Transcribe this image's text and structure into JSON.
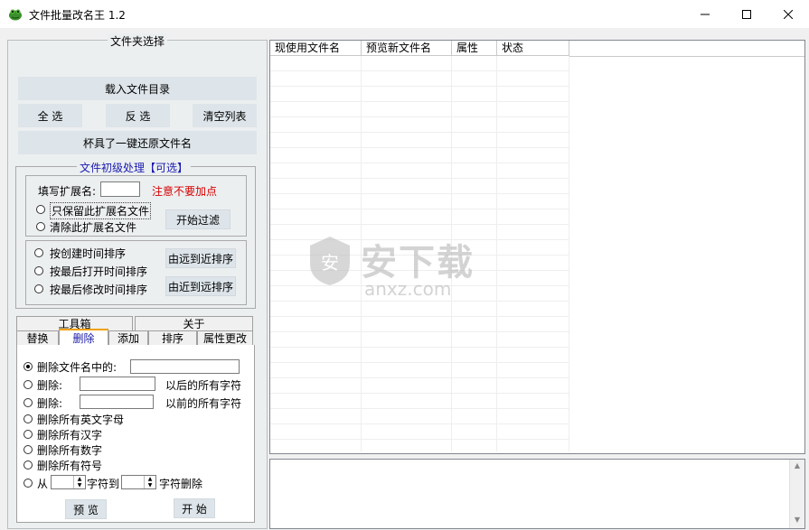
{
  "window": {
    "title": "文件批量改名王  1.2",
    "minimize_glyph": "—",
    "maximize_glyph": "☐",
    "close_glyph": "✕",
    "icon": "frog-app-icon"
  },
  "folder_group": {
    "legend": "文件夹选择",
    "load_dir": "载入文件目录",
    "select_all": "全 选",
    "invert_select": "反 选",
    "clear_list": "清空列表",
    "restore_names": "杯具了一键还原文件名"
  },
  "prefilter_group": {
    "legend": "文件初级处理【可选】",
    "ext_label": "填写扩展名:",
    "ext_value": "",
    "warning": "注意不要加点",
    "keep_ext": "只保留此扩展名文件",
    "remove_ext": "清除此扩展名文件",
    "start_filter": "开始过滤",
    "sort_create": "按创建时间排序",
    "sort_open": "按最后打开时间排序",
    "sort_modify": "按最后修改时间排序",
    "far_to_near": "由远到近排序",
    "near_to_far": "由近到远排序"
  },
  "tabs_top": [
    "工具箱",
    "关于"
  ],
  "tabs": [
    "替换",
    "删除",
    "添加",
    "排序",
    "属性更改"
  ],
  "delete_tab": {
    "opt_contains": "删除文件名中的:",
    "opt_after": "删除:",
    "after_suffix": "以后的所有字符",
    "opt_before": "删除:",
    "before_suffix": "以前的所有字符",
    "opt_english": "删除所有英文字母",
    "opt_chinese": "删除所有汉字",
    "opt_digits": "删除所有数字",
    "opt_symbols": "删除所有符号",
    "opt_range_from": "从",
    "range_to": "字符到",
    "range_delete": "字符删除",
    "preview": "预 览",
    "start": "开 始"
  },
  "file_list": {
    "columns": [
      "现使用文件名",
      "预览新文件名",
      "属性",
      "状态"
    ],
    "rows": []
  },
  "watermark": {
    "brand": "安下载",
    "domain": "anxz.com"
  },
  "colors": {
    "button_bg": "#dde5ea",
    "warning_red": "#d40000",
    "legend_blue": "#1a1ab0"
  }
}
